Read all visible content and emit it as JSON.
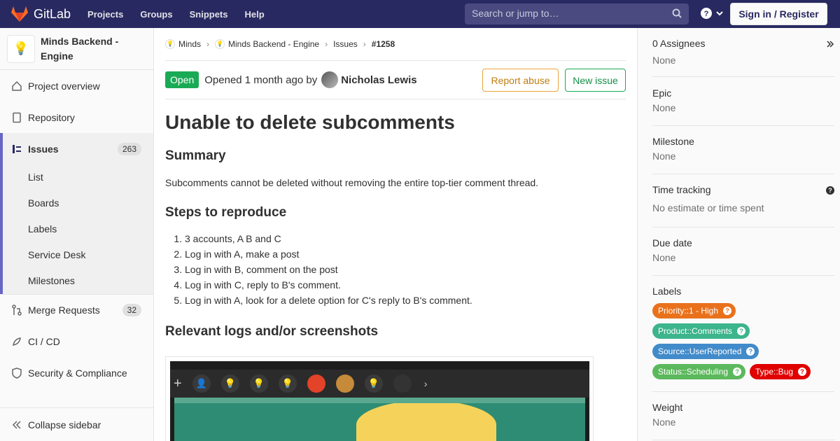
{
  "topbar": {
    "brand": "GitLab",
    "nav": [
      "Projects",
      "Groups",
      "Snippets",
      "Help"
    ],
    "search_placeholder": "Search or jump to…",
    "signin": "Sign in / Register"
  },
  "sidebar": {
    "project_name": "Minds Backend - Engine",
    "items": [
      {
        "label": "Project overview",
        "icon": "home-icon"
      },
      {
        "label": "Repository",
        "icon": "doc-icon"
      },
      {
        "label": "Issues",
        "icon": "issues-icon",
        "count": "263"
      },
      {
        "label": "Merge Requests",
        "icon": "merge-icon",
        "count": "32"
      },
      {
        "label": "CI / CD",
        "icon": "rocket-icon"
      },
      {
        "label": "Security & Compliance",
        "icon": "shield-icon"
      }
    ],
    "issue_sub": [
      "List",
      "Boards",
      "Labels",
      "Service Desk",
      "Milestones"
    ],
    "collapse": "Collapse sidebar"
  },
  "breadcrumb": {
    "items": [
      "Minds",
      "Minds Backend - Engine",
      "Issues",
      "#1258"
    ]
  },
  "issue": {
    "status": "Open",
    "opened_text": "Opened 1 month ago by",
    "author": "Nicholas Lewis",
    "report_abuse": "Report abuse",
    "new_issue": "New issue",
    "title": "Unable to delete subcomments",
    "summary_heading": "Summary",
    "summary_text": "Subcomments cannot be deleted without removing the entire top-tier comment thread.",
    "steps_heading": "Steps to reproduce",
    "steps": [
      "3 accounts, A B and C",
      "Log in with A, make a post",
      "Log in with B, comment on the post",
      "Log in with C, reply to B's comment.",
      "Log in with A, look for a delete option for C's reply to B's comment."
    ],
    "logs_heading": "Relevant logs and/or screenshots"
  },
  "right_sidebar": {
    "assignees_title": "0 Assignees",
    "assignees_value": "None",
    "epic_title": "Epic",
    "epic_value": "None",
    "milestone_title": "Milestone",
    "milestone_value": "None",
    "time_title": "Time tracking",
    "time_value": "No estimate or time spent",
    "due_title": "Due date",
    "due_value": "None",
    "labels_title": "Labels",
    "labels": [
      {
        "text": "Priority::1 - High",
        "color": "#e9711c"
      },
      {
        "text": "Product::Comments",
        "color": "#3cb48c"
      },
      {
        "text": "Source::UserReported",
        "color": "#428bca"
      },
      {
        "text": "Status::Scheduling",
        "color": "#5cb85c"
      },
      {
        "text": "Type::Bug",
        "color": "#e00000"
      }
    ],
    "weight_title": "Weight",
    "weight_value": "None"
  }
}
